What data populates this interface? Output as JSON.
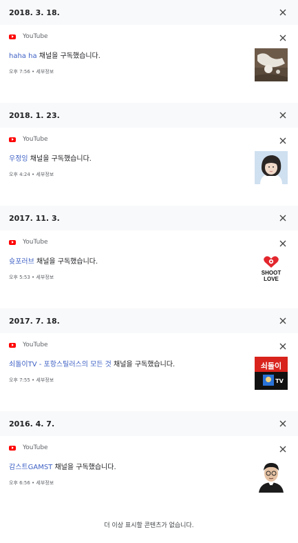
{
  "groups": [
    {
      "date": "2018. 3. 18.",
      "source": "YouTube",
      "channel": "haha ha",
      "message": " 채널을 구독했습니다.",
      "meta": "오후 7:56 • 세부정보",
      "thumb": "cat-photo"
    },
    {
      "date": "2018. 1. 23.",
      "source": "YouTube",
      "channel": "우정잉",
      "message": " 채널을 구독했습니다.",
      "meta": "오후 4:24 • 세부정보",
      "thumb": "woman-avatar"
    },
    {
      "date": "2017. 11. 3.",
      "source": "YouTube",
      "channel": "슛포러브",
      "message": " 채널을 구독했습니다.",
      "meta": "오후 5:53 • 세부정보",
      "thumb": "shoot-for-love-logo",
      "thumb_text": [
        "SHOOT",
        "LOVE"
      ]
    },
    {
      "date": "2017. 7. 18.",
      "source": "YouTube",
      "channel": "쇠돌이TV - 포항스틸러스의 모든 것",
      "message": " 채널을 구독했습니다.",
      "meta": "오후 7:55 • 세부정보",
      "thumb": "soedori-tv-logo",
      "thumb_text": [
        "쇠돌이",
        "TV"
      ]
    },
    {
      "date": "2016. 4. 7.",
      "source": "YouTube",
      "channel": "감스트GAMST",
      "message": " 채널을 구독했습니다.",
      "meta": "오후 6:56 • 세부정보",
      "thumb": "man-portrait"
    }
  ],
  "footer": "더 이상 표시할 콘텐츠가 없습니다.",
  "colors": {
    "accent": "#3c5fc4",
    "youtube": "#ff0000",
    "bar": "#f8f9fa"
  }
}
